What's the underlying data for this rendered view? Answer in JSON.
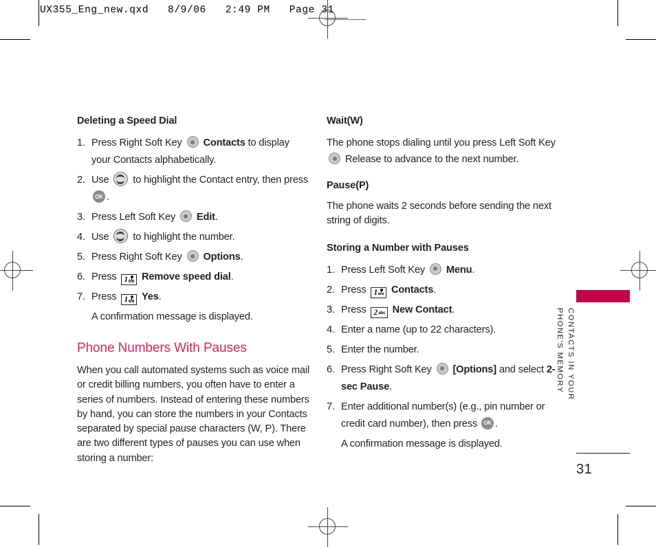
{
  "page": {
    "slug": "UX355_Eng_new.qxd   8/9/06   2:49 PM   Page 31",
    "folio": "31",
    "tab_line1": "CONTACTS IN YOUR",
    "tab_line2": "PHONE'S MEMORY",
    "accent_magenta": "#C3064B",
    "accent_pink": "#D6245A"
  },
  "left": {
    "heading_deleting": "Deleting a Speed Dial",
    "steps": [
      {
        "num": "1.",
        "parts": [
          {
            "type": "text",
            "value": "Press Right Soft Key "
          },
          {
            "type": "icon",
            "value": "soft-key-icon"
          },
          {
            "type": "bold",
            "value": "Contacts"
          },
          {
            "type": "text",
            "value": " to display your Contacts alphabetically."
          }
        ]
      },
      {
        "num": "2.",
        "parts": [
          {
            "type": "text",
            "value": "Use "
          },
          {
            "type": "icon",
            "value": "navigation-key-icon"
          },
          {
            "type": "text",
            "value": " to highlight the Contact entry, then press "
          },
          {
            "type": "icon",
            "value": "ok-key-icon"
          },
          {
            "type": "text",
            "value": "."
          }
        ]
      },
      {
        "num": "3.",
        "parts": [
          {
            "type": "text",
            "value": "Press Left Soft Key "
          },
          {
            "type": "icon",
            "value": "soft-key-icon"
          },
          {
            "type": "bold",
            "value": "Edit"
          },
          {
            "type": "text",
            "value": "."
          }
        ]
      },
      {
        "num": "4.",
        "parts": [
          {
            "type": "text",
            "value": "Use "
          },
          {
            "type": "icon",
            "value": "navigation-key-icon"
          },
          {
            "type": "text",
            "value": " to highlight the number."
          }
        ]
      },
      {
        "num": "5.",
        "parts": [
          {
            "type": "text",
            "value": "Press Right Soft Key "
          },
          {
            "type": "icon",
            "value": "soft-key-icon"
          },
          {
            "type": "bold",
            "value": "Options"
          },
          {
            "type": "text",
            "value": "."
          }
        ]
      },
      {
        "num": "6.",
        "parts": [
          {
            "type": "text",
            "value": "Press "
          },
          {
            "type": "icon",
            "value": "key-1-icon"
          },
          {
            "type": "bold",
            "value": "Remove speed dial"
          },
          {
            "type": "text",
            "value": "."
          }
        ]
      },
      {
        "num": "7.",
        "parts": [
          {
            "type": "text",
            "value": "Press "
          },
          {
            "type": "icon",
            "value": "key-1-icon"
          },
          {
            "type": "bold",
            "value": "Yes"
          },
          {
            "type": "text",
            "value": "."
          }
        ]
      }
    ],
    "note": "A confirmation message is displayed.",
    "heading_pauses": "Phone Numbers With Pauses",
    "paragraph_pauses": "When you call automated systems such as voice mail or credit billing numbers, you often have to enter a series of numbers. Instead of entering these numbers by hand, you can store the numbers in your Contacts separated by special pause characters (W, P). There are two different types of pauses you can use when storing a number:"
  },
  "right": {
    "heading_wait": "Wait(W)",
    "paragraph_wait_pre": "The phone stops dialing until you press Left Soft Key ",
    "paragraph_wait_post": " Release to advance to the next number.",
    "heading_pause": "Pause(P)",
    "paragraph_pause": "The phone waits 2 seconds before sending the next string of digits.",
    "heading_storing": "Storing a Number with Pauses",
    "steps": [
      {
        "num": "1.",
        "parts": [
          {
            "type": "text",
            "value": "Press Left Soft Key "
          },
          {
            "type": "icon",
            "value": "soft-key-icon"
          },
          {
            "type": "bold",
            "value": "Menu"
          },
          {
            "type": "text",
            "value": "."
          }
        ]
      },
      {
        "num": "2.",
        "parts": [
          {
            "type": "text",
            "value": "Press "
          },
          {
            "type": "icon",
            "value": "key-1-icon"
          },
          {
            "type": "bold",
            "value": "Contacts"
          },
          {
            "type": "text",
            "value": "."
          }
        ]
      },
      {
        "num": "3.",
        "parts": [
          {
            "type": "text",
            "value": "Press "
          },
          {
            "type": "icon",
            "value": "key-2-abc-icon"
          },
          {
            "type": "bold",
            "value": "New Contact"
          },
          {
            "type": "text",
            "value": "."
          }
        ]
      },
      {
        "num": "4.",
        "parts": [
          {
            "type": "text",
            "value": "Enter a name (up to 22 characters)."
          }
        ]
      },
      {
        "num": "5.",
        "parts": [
          {
            "type": "text",
            "value": "Enter the number."
          }
        ]
      },
      {
        "num": "6.",
        "parts": [
          {
            "type": "text",
            "value": "Press Right Soft Key "
          },
          {
            "type": "icon",
            "value": "soft-key-icon"
          },
          {
            "type": "bold",
            "value": "[Options]"
          },
          {
            "type": "text",
            "value": " and select "
          },
          {
            "type": "bold",
            "value": "2-sec Pause"
          },
          {
            "type": "text",
            "value": "."
          }
        ]
      },
      {
        "num": "7.",
        "parts": [
          {
            "type": "text",
            "value": "Enter additional number(s) (e.g., pin number or credit card number), then press "
          },
          {
            "type": "icon",
            "value": "ok-key-icon"
          },
          {
            "type": "text",
            "value": "."
          }
        ]
      }
    ],
    "note": "A confirmation message is displayed."
  },
  "key_icons": {
    "key_1_digit": "1",
    "key_2_digit": "2",
    "key_2_letters": "abc",
    "ok_label": "OK"
  }
}
